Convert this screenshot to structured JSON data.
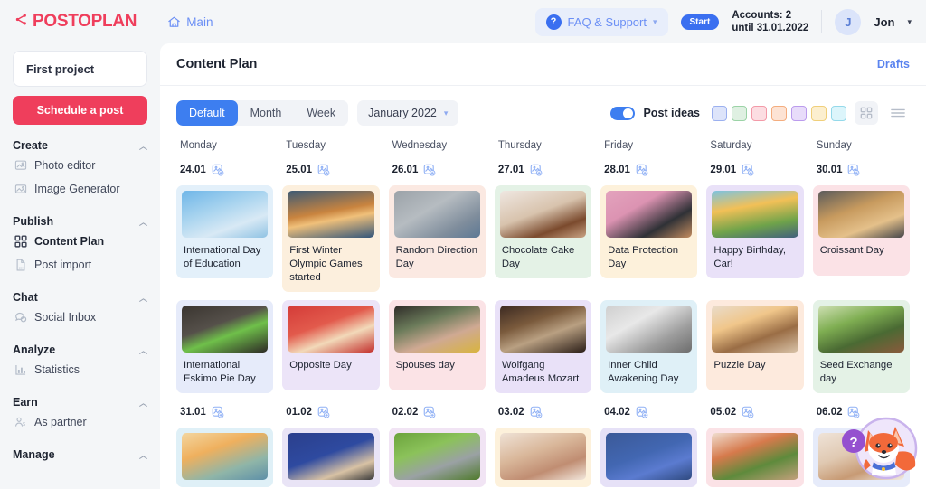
{
  "brand": {
    "name": "POSTOPLAN",
    "color": "#ef3e5c"
  },
  "topbar": {
    "main_link": "Main",
    "faq_label": "FAQ & Support",
    "faq_icon": "question-circle-icon",
    "start_badge": "Start",
    "accounts_line1": "Accounts: 2",
    "accounts_line2": "until 31.01.2022",
    "avatar_initial": "J",
    "username": "Jon"
  },
  "sidebar": {
    "project": "First project",
    "schedule_button": "Schedule a post",
    "groups": [
      {
        "title": "Create",
        "items": [
          {
            "label": "Photo editor",
            "icon": "photo-editor-icon",
            "active": false
          },
          {
            "label": "Image Generator",
            "icon": "image-generator-icon",
            "active": false
          }
        ]
      },
      {
        "title": "Publish",
        "items": [
          {
            "label": "Content Plan",
            "icon": "grid-icon",
            "active": true
          },
          {
            "label": "Post import",
            "icon": "csv-file-icon",
            "active": false
          }
        ]
      },
      {
        "title": "Chat",
        "items": [
          {
            "label": "Social Inbox",
            "icon": "chat-bubble-icon",
            "active": false
          }
        ]
      },
      {
        "title": "Analyze",
        "items": [
          {
            "label": "Statistics",
            "icon": "bar-chart-icon",
            "active": false
          }
        ]
      },
      {
        "title": "Earn",
        "items": [
          {
            "label": "As partner",
            "icon": "partner-icon",
            "active": false
          }
        ]
      },
      {
        "title": "Manage",
        "items": []
      }
    ]
  },
  "content": {
    "title": "Content Plan",
    "drafts_link": "Drafts",
    "tabs": [
      {
        "label": "Default",
        "active": true
      },
      {
        "label": "Month",
        "active": false
      },
      {
        "label": "Week",
        "active": false
      }
    ],
    "month_picker": "January 2022",
    "post_ideas_label": "Post ideas",
    "post_ideas_on": true,
    "swatches": [
      {
        "name": "blue",
        "bg": "#dde4fa",
        "border": "#9bb0ef"
      },
      {
        "name": "green",
        "bg": "#dff0e2",
        "border": "#9bd3a6"
      },
      {
        "name": "red",
        "bg": "#fcdde2",
        "border": "#f39aa8"
      },
      {
        "name": "orange",
        "bg": "#fde3d4",
        "border": "#f4ad7e"
      },
      {
        "name": "purple",
        "bg": "#e8dcfa",
        "border": "#bb9bed"
      },
      {
        "name": "yellow",
        "bg": "#fcefcf",
        "border": "#f0cf7a"
      },
      {
        "name": "cyan",
        "bg": "#dcf5fb",
        "border": "#94d9ea"
      }
    ],
    "view_grid_icon": "grid-view-icon",
    "view_list_icon": "list-view-icon"
  },
  "calendar": {
    "daynames": [
      "Monday",
      "Tuesday",
      "Wednesday",
      "Thursday",
      "Friday",
      "Saturday",
      "Sunday"
    ],
    "week1_dates": [
      "24.01",
      "25.01",
      "26.01",
      "27.01",
      "28.01",
      "29.01",
      "30.01"
    ],
    "week2_dates": [
      "31.01",
      "01.02",
      "02.02",
      "03.02",
      "04.02",
      "05.02",
      "06.02"
    ],
    "add_icon": "add-image-icon",
    "week1_row1": [
      {
        "title": "International Day of Education",
        "bg": "#e3f0fa",
        "img": "education-signpost-sky"
      },
      {
        "title": "First Winter Olympic Games started",
        "bg": "#fcefdd",
        "img": "sprinters-start-line"
      },
      {
        "title": "Random Direction Day",
        "bg": "#fbe9e2",
        "img": "direction-signs-grey"
      },
      {
        "title": "Chocolate Cake Day",
        "bg": "#e4f2e6",
        "img": "chocolate-cake-slice"
      },
      {
        "title": "Data Protection Day",
        "bg": "#fdf1db",
        "img": "padlock-devices-pink"
      },
      {
        "title": "Happy Birthday, Car!",
        "bg": "#e9e1f8",
        "img": "yellow-car-mountains"
      },
      {
        "title": "Croissant Day",
        "bg": "#fbe2e6",
        "img": "croissants-tray"
      }
    ],
    "week1_row2": [
      {
        "title": "International Eskimo Pie Day",
        "bg": "#e6ebfa",
        "img": "green-ice-cream-bar"
      },
      {
        "title": "Opposite Day",
        "bg": "#ece4f8",
        "img": "people-celebrating-red-wall"
      },
      {
        "title": "Spouses day",
        "bg": "#fbe3e6",
        "img": "elderly-couple-flowers"
      },
      {
        "title": "Wolfgang Amadeus Mozart",
        "bg": "#e9e1f8",
        "img": "mozart-painting"
      },
      {
        "title": "Inner Child Awakening Day",
        "bg": "#dff0f7",
        "img": "statue-grey"
      },
      {
        "title": "Puzzle Day",
        "bg": "#fdeadd",
        "img": "puzzle-pieces-hands"
      },
      {
        "title": "Seed Exchange day",
        "bg": "#e4f2e6",
        "img": "seedlings-pots"
      }
    ],
    "week2_row1": [
      {
        "title": "",
        "bg": "#dff0f7",
        "img": "sunset-beach"
      },
      {
        "title": "",
        "bg": "#e9e4f6",
        "img": "blue-laptop-lock"
      },
      {
        "title": "",
        "bg": "#f1e4f4",
        "img": "koala-green"
      },
      {
        "title": "",
        "bg": "#fdf1db",
        "img": "two-women-kitchen"
      },
      {
        "title": "",
        "bg": "#e6e1f7",
        "img": "facebook-blue-card"
      },
      {
        "title": "",
        "bg": "#fbe2e6",
        "img": "salad-bowl"
      },
      {
        "title": "",
        "bg": "#e6ebfa",
        "img": "woman-portrait"
      }
    ]
  },
  "helper": {
    "icon": "fox-mascot-help-icon",
    "badge": "?"
  }
}
